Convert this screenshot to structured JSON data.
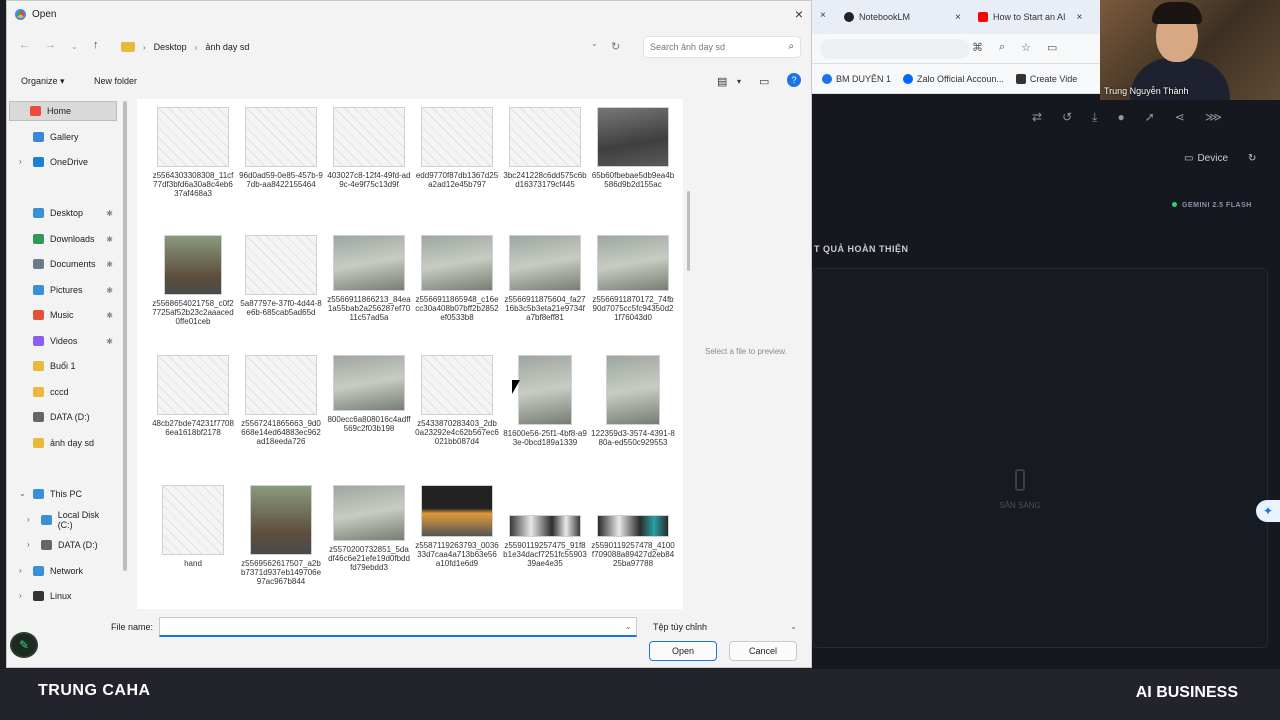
{
  "browser": {
    "tabs": [
      {
        "label": "NotebookLM",
        "close": "×"
      },
      {
        "label": "How to Start an AI",
        "close": "×"
      }
    ],
    "first_tab_close": "×",
    "bookmarks": [
      "BM DUYÊN 1",
      "Zalo Official Accoun...",
      "Create Vide"
    ],
    "bookmark_colors": [
      "#1a73e8",
      "#0068ff",
      "#333333"
    ]
  },
  "app": {
    "device_label": "Device",
    "model_badge": "GEMINI 2.5 FLASH",
    "result_header": "T QUẢ HOÀN THIỆN",
    "placeholder_text": "SẴN SÀNG"
  },
  "webcam": {
    "name": "Trung Nguyễn Thành"
  },
  "overlay": {
    "left_brand": "TRUNG CAHA",
    "right_brand": "AI BUSINESS"
  },
  "dialog": {
    "title": "Open",
    "close": "×",
    "breadcrumb": [
      "Desktop",
      "ảnh dạy sd"
    ],
    "search_placeholder": "Search ảnh dạy sd",
    "organize_label": "Organize ▾",
    "new_folder_label": "New folder",
    "sidebar": [
      {
        "label": "Home",
        "color": "#e94b3c"
      },
      {
        "label": "Gallery",
        "color": "#3a86d8"
      },
      {
        "label": "OneDrive",
        "color": "#1e7fd6"
      },
      {
        "label": "Desktop",
        "color": "#3a8fd8"
      },
      {
        "label": "Downloads",
        "color": "#2f9a57"
      },
      {
        "label": "Documents",
        "color": "#6c7a89"
      },
      {
        "label": "Pictures",
        "color": "#3a8fd8"
      },
      {
        "label": "Music",
        "color": "#e0533a"
      },
      {
        "label": "Videos",
        "color": "#8b5cf6"
      },
      {
        "label": "Buổi 1",
        "color": "#e8b93a"
      },
      {
        "label": "cccd",
        "color": "#e8b93a"
      },
      {
        "label": "DATA (D:)",
        "color": "#666666"
      },
      {
        "label": "ảnh dạy sd",
        "color": "#e8b93a"
      },
      {
        "label": "This PC",
        "color": "#3a8fd8"
      },
      {
        "label": "Local Disk (C:)",
        "color": "#3a8fd8"
      },
      {
        "label": "DATA (D:)",
        "color": "#666666"
      },
      {
        "label": "Network",
        "color": "#3a8fd8"
      },
      {
        "label": "Linux",
        "color": "#333333"
      }
    ],
    "files": [
      {
        "name": "z5564303308308_11cf77df3bfd6a30a8c4eb637af468a3",
        "kind": "sketch"
      },
      {
        "name": "96d0ad59-0e85-457b-97db-aa8422155464",
        "kind": "sketch"
      },
      {
        "name": "403027c8-12f4-49fd-ad9c-4e9f75c13d9f",
        "kind": "sketch"
      },
      {
        "name": "edd9770f87db1367d25a2ad12e45b797",
        "kind": "sketch"
      },
      {
        "name": "3bc241228c6dd575c6bd16373179cf445",
        "kind": "sketch"
      },
      {
        "name": "65b60fbebae5db9ea4b586d9b2d155ac",
        "kind": "dark"
      },
      {
        "name": "z5568654021758_c0f27725af52b23c2aaaced0ffe01ceb",
        "kind": "house"
      },
      {
        "name": "5a87797e-37f0-4d44-8e6b-685cab5ad65d",
        "kind": "sketch"
      },
      {
        "name": "z5566911866213_84ea1a55bab2a256287ef7011c57ad5a",
        "kind": "render"
      },
      {
        "name": "z5566911865948_c16ecc30a408b07bff2b2852ef0533b8",
        "kind": "render"
      },
      {
        "name": "z5566911875604_fa2716b3c5b3eta21e9734fa7bf8eff81",
        "kind": "render"
      },
      {
        "name": "z5566911870172_74fb90d7075cc5fc94350d21f76043d0",
        "kind": "render"
      },
      {
        "name": "48cb27bde74231f77086ea1618bf2178",
        "kind": "sketch"
      },
      {
        "name": "z5567241865663_9d0668e14ed64883ec962ad18eeda726",
        "kind": "sketch"
      },
      {
        "name": "800ecc6a808016c4adff569c2f03b198",
        "kind": "render"
      },
      {
        "name": "z5433870283403_2db0a23292e4c62b567ec6021bb087d4",
        "kind": "sketch"
      },
      {
        "name": "81600e56-25f1-4bf8-a93e-0bcd189a1339",
        "kind": "render"
      },
      {
        "name": "122359d3-3574-4391-880a-ed550c929553",
        "kind": "render"
      },
      {
        "name": "hand",
        "kind": "sketch"
      },
      {
        "name": "z5569562617507_a2bb7371d937eb149706e97ac967b844",
        "kind": "house"
      },
      {
        "name": "z5570200732851_5dadf46c6e21efe19d0fbddfd79ebdd3",
        "kind": "render"
      },
      {
        "name": "z5587119263793_003633d7caa4a713b63e56a10fd1e6d9",
        "kind": "night"
      },
      {
        "name": "z5590119257475_91f8b1e34dacf7251fc5590339ae4e35",
        "kind": "strip"
      },
      {
        "name": "z5590119257478_4100f709088a89427d2eb8425ba97788",
        "kind": "stripg"
      }
    ],
    "preview_text": "Select a file to preview.",
    "file_name_label": "File name:",
    "file_name_value": "",
    "file_type": "Tệp tùy chỉnh",
    "open_label": "Open",
    "cancel_label": "Cancel"
  }
}
